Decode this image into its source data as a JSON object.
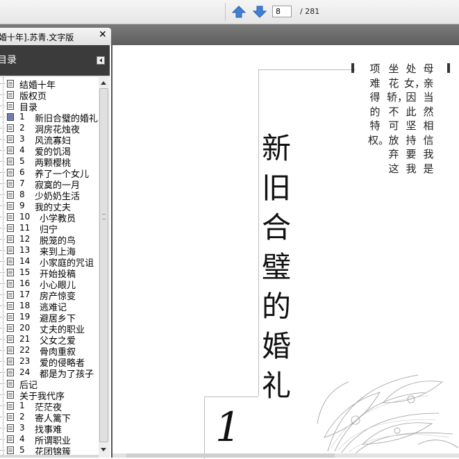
{
  "toolbar": {
    "current_page": "8",
    "total_pages": "/ 281"
  },
  "tab": {
    "title": "婚十年].苏青.文字版",
    "close_symbol": "✕"
  },
  "sidebar": {
    "title": "目录",
    "items": [
      {
        "num": "",
        "label": "结婚十年"
      },
      {
        "num": "",
        "label": "版权页"
      },
      {
        "num": "",
        "label": "目录"
      },
      {
        "num": "1",
        "label": "新旧合璧的婚礼"
      },
      {
        "num": "2",
        "label": "洞房花烛夜"
      },
      {
        "num": "3",
        "label": "风流寡妇"
      },
      {
        "num": "4",
        "label": "爱的饥渴"
      },
      {
        "num": "5",
        "label": "两颗樱桃"
      },
      {
        "num": "6",
        "label": "养了一个女儿"
      },
      {
        "num": "7",
        "label": "寂寞的一月"
      },
      {
        "num": "8",
        "label": "少奶奶生活"
      },
      {
        "num": "9",
        "label": "我的丈夫"
      },
      {
        "num": "10",
        "label": "小学教员"
      },
      {
        "num": "11",
        "label": "归宁"
      },
      {
        "num": "12",
        "label": "脱笼的鸟"
      },
      {
        "num": "13",
        "label": "来到上海"
      },
      {
        "num": "14",
        "label": "小家庭的咒诅"
      },
      {
        "num": "15",
        "label": "开始投稿"
      },
      {
        "num": "16",
        "label": "小心眼儿"
      },
      {
        "num": "17",
        "label": "房产惊变"
      },
      {
        "num": "18",
        "label": "逃难记"
      },
      {
        "num": "19",
        "label": "避居乡下"
      },
      {
        "num": "20",
        "label": "丈夫的职业"
      },
      {
        "num": "21",
        "label": "父女之爱"
      },
      {
        "num": "22",
        "label": "骨肉重叙"
      },
      {
        "num": "23",
        "label": "爱的侵略者"
      },
      {
        "num": "24",
        "label": "都是为了孩子"
      },
      {
        "num": "",
        "label": "后记"
      },
      {
        "num": "",
        "label": "关于我代序"
      },
      {
        "num": "1",
        "label": "茫茫夜"
      },
      {
        "num": "2",
        "label": "寄人篱下"
      },
      {
        "num": "3",
        "label": "找事难"
      },
      {
        "num": "4",
        "label": "所谓职业"
      },
      {
        "num": "5",
        "label": "花团锦簇"
      }
    ]
  },
  "page": {
    "chapter_title": "新旧合璧的婚礼",
    "chapter_number": "1",
    "body_columns": [
      "母亲当然相信我是",
      "处女，因此坚持要我",
      "坐花轿，不可放弃这",
      "项难得的特权。"
    ]
  },
  "colors": {
    "tab_bar": "#6b6b6b",
    "sidebar_header": "#3b3b3b",
    "nav_arrow": "#3f7fd9"
  },
  "icons": [
    "arrow-up-icon",
    "arrow-down-icon",
    "close-icon",
    "collapse-arrow-icon",
    "page-icon",
    "current-page-icon"
  ]
}
